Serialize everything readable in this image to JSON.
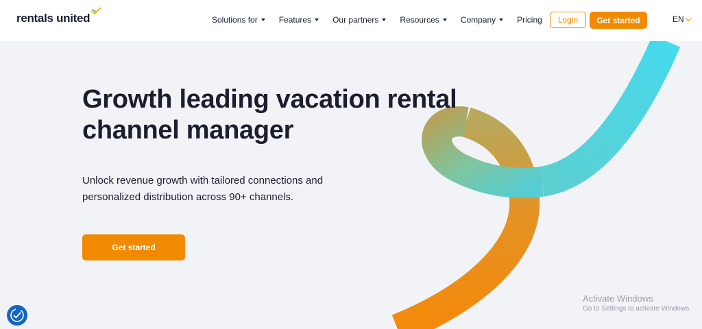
{
  "header": {
    "logo": "rentals united",
    "nav": [
      {
        "label": "Solutions for",
        "dropdown": true
      },
      {
        "label": "Features",
        "dropdown": true
      },
      {
        "label": "Our partners",
        "dropdown": true
      },
      {
        "label": "Resources",
        "dropdown": true
      },
      {
        "label": "Company",
        "dropdown": true
      },
      {
        "label": "Pricing",
        "dropdown": false
      }
    ],
    "login_label": "Login",
    "get_started_label": "Get started",
    "language": "EN"
  },
  "hero": {
    "title_line1": "Growth leading vacation rental",
    "title_line2": "channel manager",
    "subtitle_line1": "Unlock revenue growth with tailored connections and",
    "subtitle_line2": "personalized distribution across 90+ channels.",
    "cta_label": "Get started"
  },
  "overlay": {
    "activate_title": "Activate Windows",
    "activate_sub": "Go to Settings to activate Windows."
  },
  "colors": {
    "accent": "#f28a00",
    "text": "#1b1e2e",
    "background": "#f2f3f7",
    "swirl_teal": "#4dd6ea",
    "swirl_orange": "#f5890a"
  },
  "icons": {
    "accessibility": "accessibility-icon",
    "logo_mark": "logo-checkmark-icon"
  }
}
